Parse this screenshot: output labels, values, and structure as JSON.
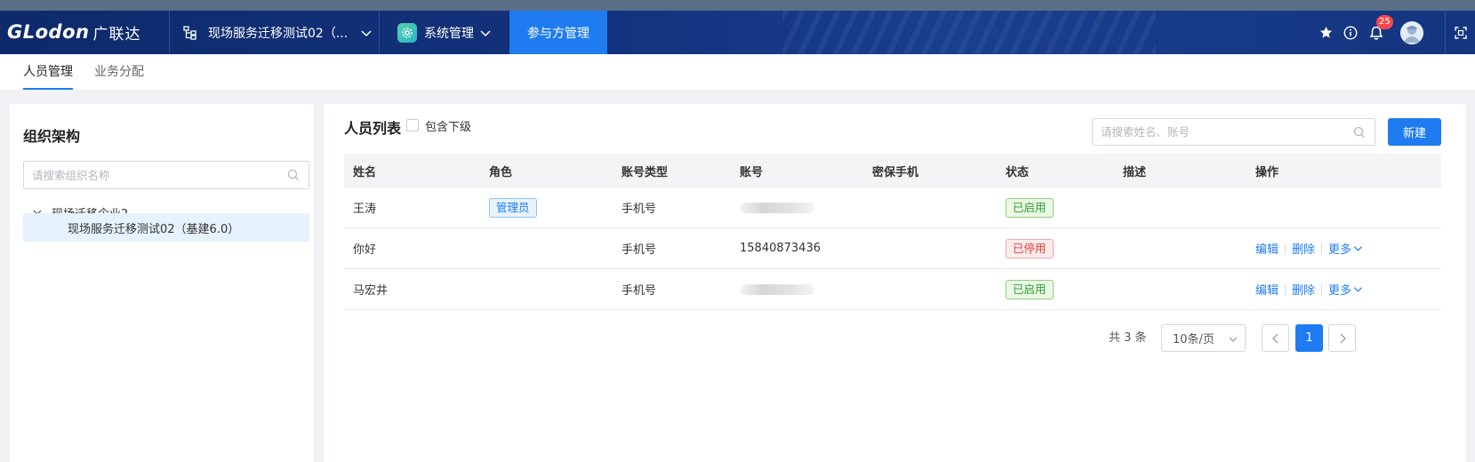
{
  "topbar": {
    "logo_text": "GLodon",
    "brand_cn": "广联达",
    "project_name": "现场服务迁移测试02（...",
    "system_menu": "系统管理",
    "active_tab": "参与方管理",
    "notification_count": "25"
  },
  "subtabs": [
    {
      "label": "人员管理",
      "active": true
    },
    {
      "label": "业务分配",
      "active": false
    }
  ],
  "org_panel": {
    "title": "组织架构",
    "search_placeholder": "请搜索组织名称",
    "tree": [
      {
        "label": "现场迁移企业2",
        "expanded": true
      },
      {
        "label": "现场服务迁移测试02（基建6.0）",
        "selected": true
      }
    ]
  },
  "staff_panel": {
    "title": "人员列表",
    "include_sub_label": "包含下级",
    "search_placeholder": "请搜索姓名、账号",
    "new_button": "新建"
  },
  "table": {
    "headers": [
      "姓名",
      "角色",
      "账号类型",
      "账号",
      "密保手机",
      "状态",
      "描述",
      "操作"
    ],
    "rows": [
      {
        "name": "王涛",
        "role": "管理员",
        "account_type": "手机号",
        "account": "",
        "phone": "",
        "status": "已启用",
        "desc": "",
        "ops": []
      },
      {
        "name": "你好",
        "role": "",
        "account_type": "手机号",
        "account": "15840873436",
        "phone": "",
        "status": "已停用",
        "desc": "",
        "ops": [
          "编辑",
          "删除",
          "更多"
        ]
      },
      {
        "name": "马宏井",
        "role": "",
        "account_type": "手机号",
        "account": "",
        "phone": "",
        "status": "已启用",
        "desc": "",
        "ops": [
          "编辑",
          "删除",
          "更多"
        ]
      }
    ]
  },
  "pagination": {
    "total": "共 3 条",
    "page_size": "10条/页",
    "current_page": "1"
  },
  "colors": {
    "primary": "#1e7cf0",
    "topbar": "#12327c",
    "enabled": "#2f9e2f",
    "disabled": "#e03c3c"
  }
}
